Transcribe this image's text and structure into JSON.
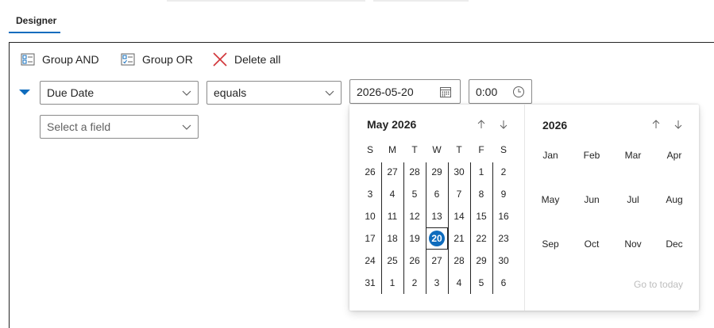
{
  "tabs": {
    "designer_label": "Designer"
  },
  "toolbar": {
    "group_and_label": "Group AND",
    "group_or_label": "Group OR",
    "delete_all_label": "Delete all"
  },
  "condition": {
    "field_value": "Due Date",
    "operator_value": "equals",
    "date_value": "2026-05-20",
    "time_value": "0:00"
  },
  "new_row": {
    "field_placeholder": "Select a field"
  },
  "calendar": {
    "month_title": "May 2026",
    "year_title": "2026",
    "weekdays": [
      "S",
      "M",
      "T",
      "W",
      "T",
      "F",
      "S"
    ],
    "weeks": [
      [
        "26",
        "27",
        "28",
        "29",
        "30",
        "1",
        "2"
      ],
      [
        "3",
        "4",
        "5",
        "6",
        "7",
        "8",
        "9"
      ],
      [
        "10",
        "11",
        "12",
        "13",
        "14",
        "15",
        "16"
      ],
      [
        "17",
        "18",
        "19",
        "20",
        "21",
        "22",
        "23"
      ],
      [
        "24",
        "25",
        "26",
        "27",
        "28",
        "29",
        "30"
      ],
      [
        "31",
        "1",
        "2",
        "3",
        "4",
        "5",
        "6"
      ]
    ],
    "selected_day": "20",
    "months": [
      "Jan",
      "Feb",
      "Mar",
      "Apr",
      "May",
      "Jun",
      "Jul",
      "Aug",
      "Sep",
      "Oct",
      "Nov",
      "Dec"
    ],
    "goto_today": "Go to today"
  },
  "colors": {
    "accent": "#0f6cbd",
    "delete": "#d13438"
  }
}
